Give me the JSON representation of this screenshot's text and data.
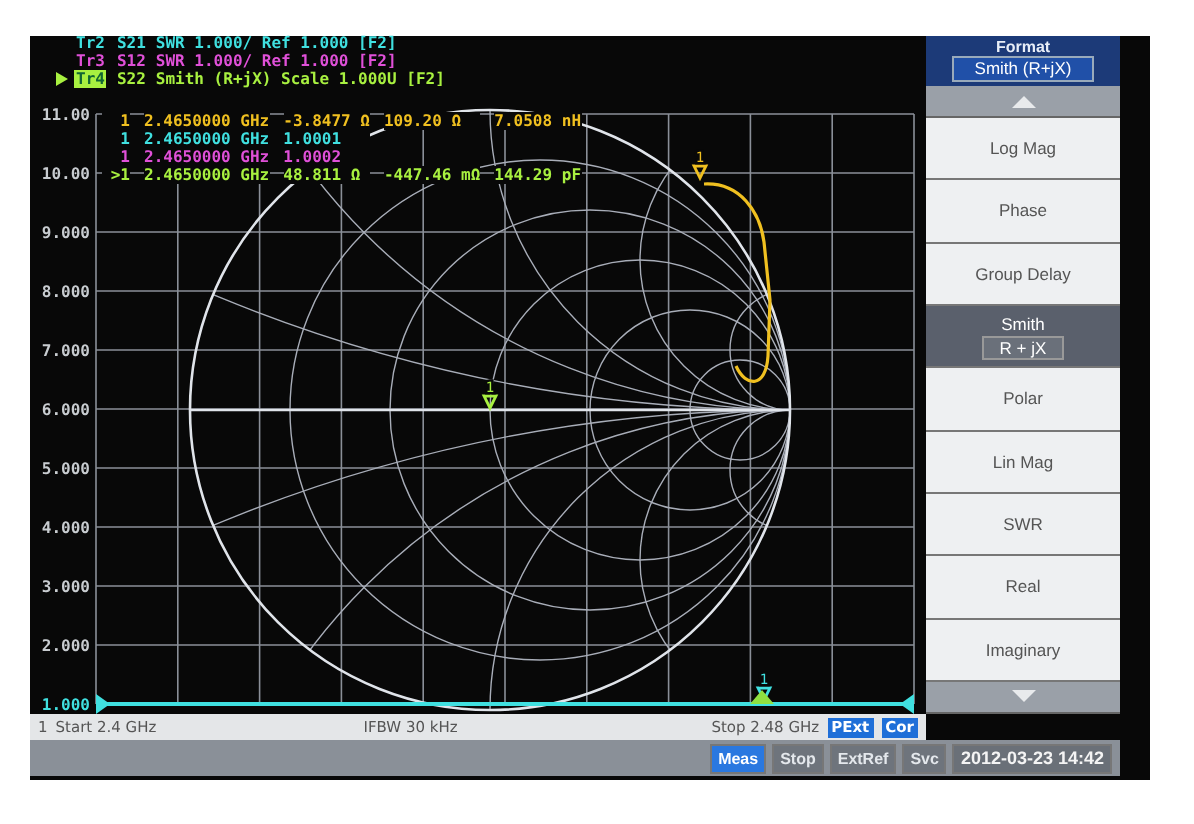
{
  "traces": [
    {
      "label": "Tr2",
      "param": "S21",
      "text": "SWR 1.000/ Ref 1.000 [F2]",
      "color": "#40e0e0",
      "active": false
    },
    {
      "label": "Tr3",
      "param": "S12",
      "text": "SWR 1.000/ Ref 1.000 [F2]",
      "color": "#e050d8",
      "active": false
    },
    {
      "label": "Tr4",
      "param": "S22",
      "text": "Smith (R+jX) Scale 1.000U [F2]",
      "color": "#a8f040",
      "active": true
    }
  ],
  "marker_readouts": [
    {
      "label": "1",
      "color": "#f0c020",
      "values": [
        "2.4650000 GHz",
        "-3.8477 Ω",
        "109.20 Ω",
        "7.0508 nH"
      ]
    },
    {
      "label": "1",
      "color": "#40e0e0",
      "values": [
        "2.4650000 GHz",
        "1.0001"
      ]
    },
    {
      "label": "1",
      "color": "#e050d8",
      "values": [
        "2.4650000 GHz",
        "1.0002"
      ]
    },
    {
      "label": ">1",
      "color": "#a8f040",
      "values": [
        "2.4650000 GHz",
        "48.811 Ω",
        "-447.46 mΩ",
        "144.29 pF"
      ]
    }
  ],
  "smith_markers": [
    {
      "label": "1",
      "color": "#f0c020"
    },
    {
      "label": "1",
      "color": "#a8f040"
    },
    {
      "label": "1",
      "color": "#40e0e0"
    }
  ],
  "y_axis_labels": [
    "11.00",
    "10.00",
    "9.000",
    "8.000",
    "7.000",
    "6.000",
    "5.000",
    "4.000",
    "3.000",
    "2.000",
    "1.000"
  ],
  "channel_bar": {
    "channel": "1",
    "start": "Start 2.4 GHz",
    "ifbw": "IFBW 30 kHz",
    "stop": "Stop 2.48 GHz",
    "badges": [
      "PExt",
      "Cor"
    ]
  },
  "softkeys": {
    "title": "Format",
    "value": "Smith (R+jX)",
    "keys": [
      {
        "kind": "arrow-up",
        "selected": false
      },
      {
        "kind": "key",
        "label": "Log Mag",
        "selected": false
      },
      {
        "kind": "key",
        "label": "Phase",
        "selected": false
      },
      {
        "kind": "key",
        "label": "Group Delay",
        "selected": false
      },
      {
        "kind": "key",
        "label": "Smith",
        "sublabel": "R + jX",
        "selected": true
      },
      {
        "kind": "key",
        "label": "Polar",
        "selected": false
      },
      {
        "kind": "key",
        "label": "Lin Mag",
        "selected": false
      },
      {
        "kind": "key",
        "label": "SWR",
        "selected": false
      },
      {
        "kind": "key",
        "label": "Real",
        "selected": false
      },
      {
        "kind": "key",
        "label": "Imaginary",
        "selected": false
      },
      {
        "kind": "arrow-down",
        "selected": false
      }
    ]
  },
  "status_bar": {
    "items": [
      {
        "label": "Meas",
        "on": true
      },
      {
        "label": "Stop",
        "on": false
      },
      {
        "label": "ExtRef",
        "on": false
      },
      {
        "label": "Svc",
        "on": false
      }
    ],
    "datetime": "2012-03-23 14:42"
  }
}
